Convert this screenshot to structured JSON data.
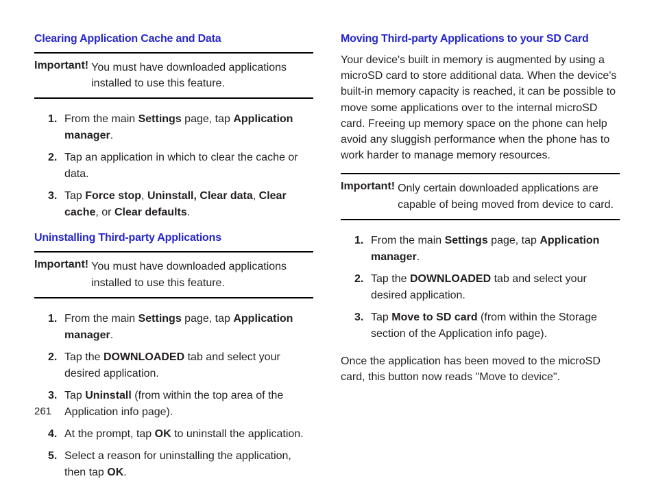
{
  "pageNumber": "261",
  "col1": {
    "section1": {
      "heading": "Clearing Application Cache and Data",
      "importantLabel": "Important!",
      "importantText": "You must have downloaded applications installed to use this feature.",
      "steps": [
        {
          "num": "1.",
          "pre": "From the main ",
          "b1": "Settings",
          "mid1": " page, tap ",
          "b2": "Application manager",
          "post": "."
        },
        {
          "num": "2.",
          "text": "Tap an application in which to clear the cache or data."
        },
        {
          "num": "3.",
          "pre": "Tap ",
          "b1": "Force stop",
          "mid1": ", ",
          "b2": "Uninstall, Clear data",
          "mid2": ", ",
          "b3": "Clear cache",
          "mid3": ", or ",
          "b4": "Clear defaults",
          "post": "."
        }
      ]
    },
    "section2": {
      "heading": "Uninstalling Third-party Applications",
      "importantLabel": "Important!",
      "importantText": "You must have downloaded applications installed to use this feature.",
      "steps": [
        {
          "num": "1.",
          "pre": "From the main ",
          "b1": "Settings",
          "mid1": " page, tap ",
          "b2": "Application manager",
          "post": "."
        },
        {
          "num": "2.",
          "pre": "Tap the ",
          "b1": "DOWNLOADED",
          "post": " tab and select your desired application."
        },
        {
          "num": "3.",
          "pre": "Tap ",
          "b1": "Uninstall",
          "post": " (from within the top area of the Application info page)."
        },
        {
          "num": "4.",
          "pre": "At the prompt, tap ",
          "b1": "OK",
          "post": " to uninstall the application."
        },
        {
          "num": "5.",
          "pre": "Select a reason for uninstalling the application, then tap ",
          "b1": "OK",
          "post": "."
        }
      ]
    }
  },
  "col2": {
    "section1": {
      "heading": "Moving Third-party Applications to your SD Card",
      "intro": "Your device's built in memory is augmented by using a microSD card to store additional data. When the device's built-in memory capacity is reached, it can be possible to move some applications over to the internal microSD card. Freeing up memory space on the phone can help avoid any sluggish performance when the phone has to work harder to manage memory resources.",
      "importantLabel": "Important!",
      "importantText": "Only certain downloaded applications are capable of being moved from device to card.",
      "steps": [
        {
          "num": "1.",
          "pre": "From the main ",
          "b1": "Settings",
          "mid1": " page, tap ",
          "b2": "Application manager",
          "post": "."
        },
        {
          "num": "2.",
          "pre": "Tap the ",
          "b1": "DOWNLOADED",
          "post": " tab and select your desired application."
        },
        {
          "num": "3.",
          "pre": "Tap ",
          "b1": "Move to SD card",
          "post": " (from within the Storage section of the Application info page)."
        }
      ],
      "outro": "Once the application has been moved to the microSD card, this button now reads \"Move to device\"."
    }
  }
}
